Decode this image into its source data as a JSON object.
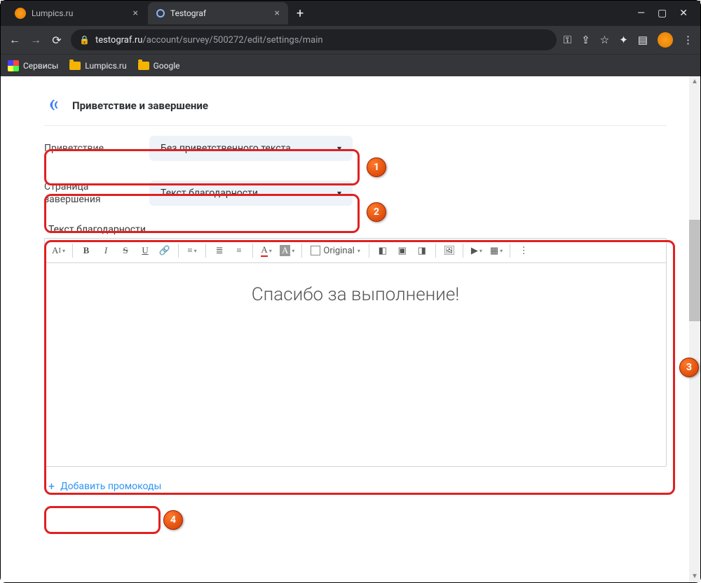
{
  "browser": {
    "tabs": [
      {
        "title": "Lumpics.ru"
      },
      {
        "title": "Testograf"
      }
    ],
    "url_host": "testograf.ru",
    "url_path": "/account/survey/500272/edit/settings/main",
    "bookmarks": {
      "services": "Сервисы",
      "lumpics": "Lumpics.ru",
      "google": "Google"
    }
  },
  "section": {
    "title": "Приветствие и завершение"
  },
  "rows": {
    "greeting_label": "Приветствие",
    "greeting_value": "Без приветственного текста",
    "completion_label": "Страница завершения",
    "completion_value": "Текст благодарности"
  },
  "editor": {
    "label": "Текст благодарности",
    "original_label": "Original",
    "body_text": "Спасибо за выполнение!"
  },
  "promo": {
    "label": "Добавить промокоды"
  },
  "badges": {
    "b1": "1",
    "b2": "2",
    "b3": "3",
    "b4": "4"
  }
}
